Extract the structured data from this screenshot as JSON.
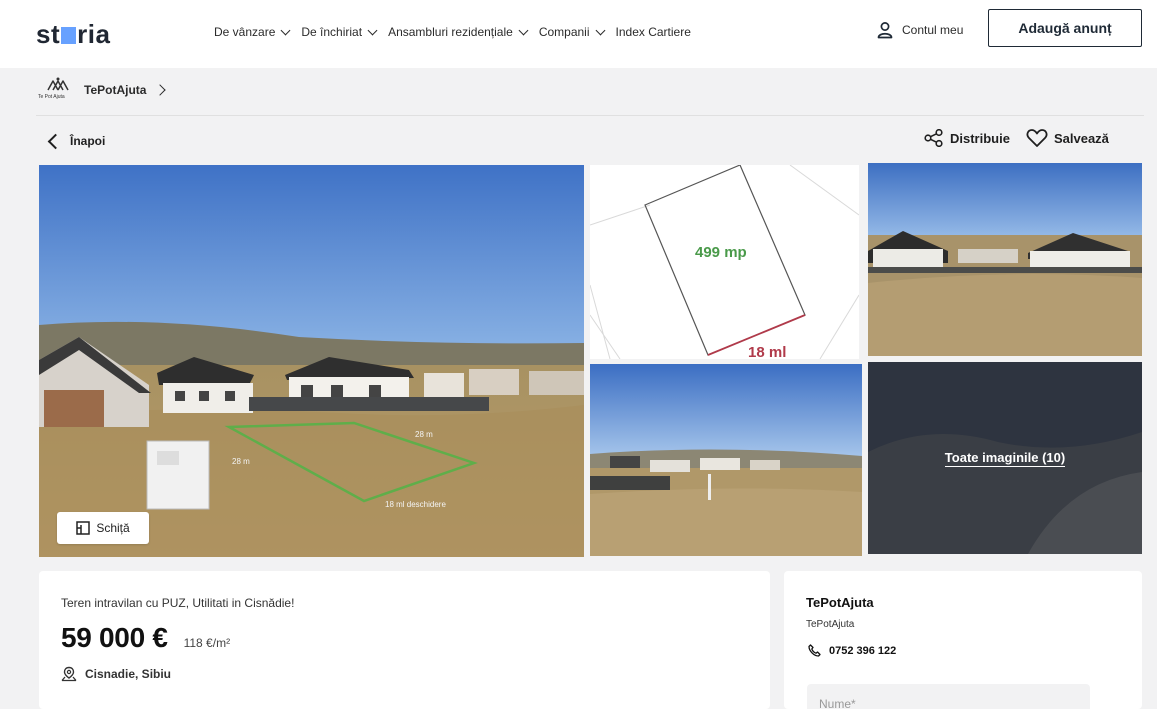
{
  "header": {
    "logo_text_left": "st",
    "logo_text_right": "ria",
    "nav": [
      {
        "label": "De vânzare",
        "icon": "chevron-down-icon"
      },
      {
        "label": "De închiriat",
        "icon": "chevron-down-icon"
      },
      {
        "label": "Ansambluri rezidențiale",
        "icon": "chevron-down-icon"
      },
      {
        "label": "Companii",
        "icon": "chevron-down-icon"
      },
      {
        "label": "Index Cartiere"
      }
    ],
    "account_label": "Contul meu",
    "add_listing_label": "Adaugă anunț"
  },
  "breadcrumb": {
    "agency_logo_small": "Te Pot Ajuta",
    "agency_label": "TePotAjuta"
  },
  "toolbar": {
    "back_label": "Înapoi",
    "share_label": "Distribuie",
    "save_label": "Salvează"
  },
  "gallery": {
    "sketch_label": "Schiță",
    "all_images_label": "Toate imaginile (10)",
    "plan_area": "499 mp",
    "plan_front": "18 ml",
    "photo_labels": {
      "side_a": "28 m",
      "side_b": "28 m",
      "front": "18 ml deschidere"
    }
  },
  "listing": {
    "title": "Teren intravilan cu PUZ, Utilitati in Cisnădie!",
    "price": "59 000 €",
    "price_per_sqm": "118 €/m²",
    "location": "Cisnadie, Sibiu"
  },
  "agent": {
    "name": "TePotAjuta",
    "subtitle": "TePotAjuta",
    "phone": "0752 396 122",
    "name_placeholder": "Nume*"
  },
  "colors": {
    "logo_accent": "#67a1ff",
    "plan_area": "#4a9a4a",
    "plan_front": "#b03a4a"
  }
}
